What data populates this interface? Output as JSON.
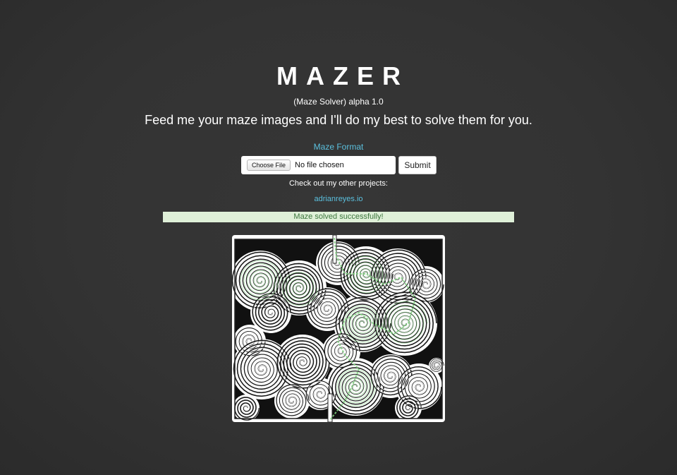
{
  "header": {
    "title": "MAZER",
    "subtitle": "(Maze Solver) alpha 1.0",
    "tagline": "Feed me your maze images and I'll do my best to solve them for you."
  },
  "links": {
    "maze_format": "Maze Format",
    "projects_label": "Check out my other projects:",
    "projects_link": "adrianreyes.io"
  },
  "upload": {
    "choose_file_label": "Choose File",
    "file_status": "No file chosen",
    "submit_label": "Submit"
  },
  "alert": {
    "message": "Maze solved successfully!"
  },
  "colors": {
    "background": "#333333",
    "link": "#5bc0de",
    "alert_bg": "#dff0d8",
    "alert_text": "#3c763d",
    "solution_path": "#7fd07f"
  },
  "maze_image": {
    "icon": "solved-spiral-maze-image"
  }
}
